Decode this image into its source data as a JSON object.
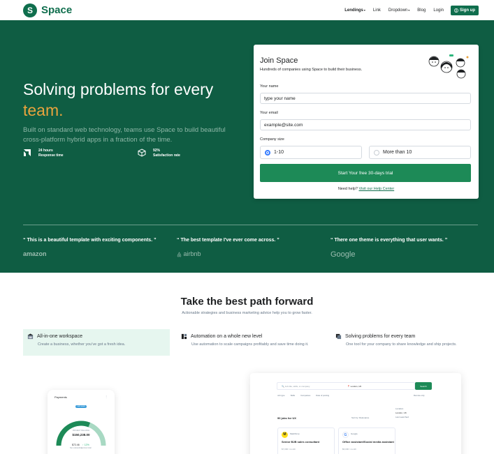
{
  "header": {
    "logo_letter": "S",
    "brand": "Space",
    "nav": [
      {
        "label": "Lendings",
        "caret": "▾"
      },
      {
        "label": "Link"
      },
      {
        "label": "Dropdown",
        "caret": "▾"
      },
      {
        "label": "Blog"
      },
      {
        "label": "Login"
      }
    ],
    "signup": "Sign up"
  },
  "hero": {
    "title_main": "Solving problems for every",
    "title_accent": "team.",
    "description": "Built on standard web technology, teams use Space to build beautiful cross-platform hybrid apps in a fraction of the time.",
    "stats": [
      {
        "value": "24 hours",
        "label": "Response time"
      },
      {
        "value": "92%",
        "label": "Satisfaction rate"
      }
    ]
  },
  "form": {
    "title": "Join Space",
    "subtitle": "Hundreds of companies using Space to build their business.",
    "name_label": "Your name",
    "name_placeholder": "type your name",
    "email_label": "Your email",
    "email_placeholder": "example@site.com",
    "size_label": "Company size",
    "size_options": [
      "1-10",
      "More than 10"
    ],
    "size_selected": "1-10",
    "cta": "Start Your free 30-days trial",
    "help_text": "Need help?",
    "help_link": "Visit our Help Center"
  },
  "testimonials": [
    {
      "quote": "“ This is a beautiful template with exciting components. ”",
      "brand": "amazon"
    },
    {
      "quote": "“ The best template I've ever come across. ”",
      "brand": "airbnb"
    },
    {
      "quote": "“ There one theme is everything that user wants. ”",
      "brand": "Google"
    }
  ],
  "section": {
    "title": "Take the best path forward",
    "subtitle": "Actionable strategies and business marketing advice help you to grow faster.",
    "features": [
      {
        "title": "All-in-one workspace",
        "desc": "Create a business, whether you've got a fresh idea.",
        "icon": "building-icon",
        "active": true
      },
      {
        "title": "Automation on a whole new level",
        "desc": "Use automation to scale campaigns profitably and save time doing it.",
        "icon": "grid-icon",
        "active": false
      },
      {
        "title": "Solving problems for every team",
        "desc": "One tool for your company to share knowledge and ship projects.",
        "icon": "layers-icon",
        "active": false
      }
    ]
  },
  "phone": {
    "header": "Payments",
    "badge": "Last week",
    "balance_label": "PROJECT BALANCE",
    "balance": "$150,238.00",
    "stat1": "$72.46",
    "stat2": "↑ 12%",
    "stat1_label": "Net outstanding",
    "stat2_label": "Invoiced total",
    "gauge_fraction": 0.62,
    "colors": {
      "primary": "#1d8a57",
      "track": "#a8d9c3"
    }
  },
  "desk": {
    "search_placeholder": "Job title, skills, or company",
    "location": "London, UK",
    "search_btn": "Search",
    "filters": [
      "Job type",
      "Skills",
      "Companies",
      "Date of posting"
    ],
    "remote": "Remote only",
    "count": "90 jobs for UX",
    "sort": "Sort by: Relevance",
    "jobs": [
      {
        "logo": "M",
        "company": "Mailchimp",
        "role": "Senior B2B sales consultant",
        "salary": "$7,000 / month"
      },
      {
        "logo": "G",
        "company": "Google",
        "role": "Office assistant/Social media assistant",
        "salary": "$6,000 / month"
      }
    ],
    "side": [
      "Location",
      "London, UK",
      "Last searched"
    ]
  }
}
